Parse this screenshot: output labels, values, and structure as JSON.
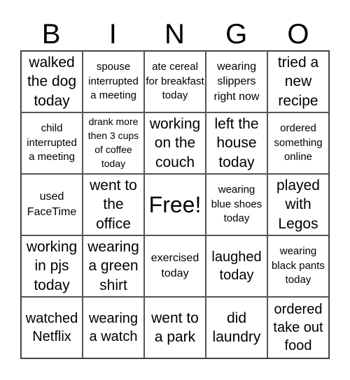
{
  "header": {
    "letters": [
      "B",
      "I",
      "N",
      "G",
      "O"
    ]
  },
  "board": {
    "cells": [
      [
        "walked the dog today",
        "spouse interrupted a meeting",
        "ate cereal for breakfast today",
        "wearing slippers right now",
        "tried a new recipe"
      ],
      [
        "child interrupted a meeting",
        "drank more then 3 cups of coffee today",
        "working on the couch",
        "left the house today",
        "ordered something online"
      ],
      [
        "used FaceTime",
        "went to the office",
        "Free!",
        "wearing blue shoes today",
        "played with Legos"
      ],
      [
        "working in pjs today",
        "wearing a green shirt",
        "exercised today",
        "laughed today",
        "wearing black pants today"
      ],
      [
        "watched Netflix",
        "wearing a watch",
        "went to a park",
        "did laundry",
        "ordered take out food"
      ]
    ]
  }
}
